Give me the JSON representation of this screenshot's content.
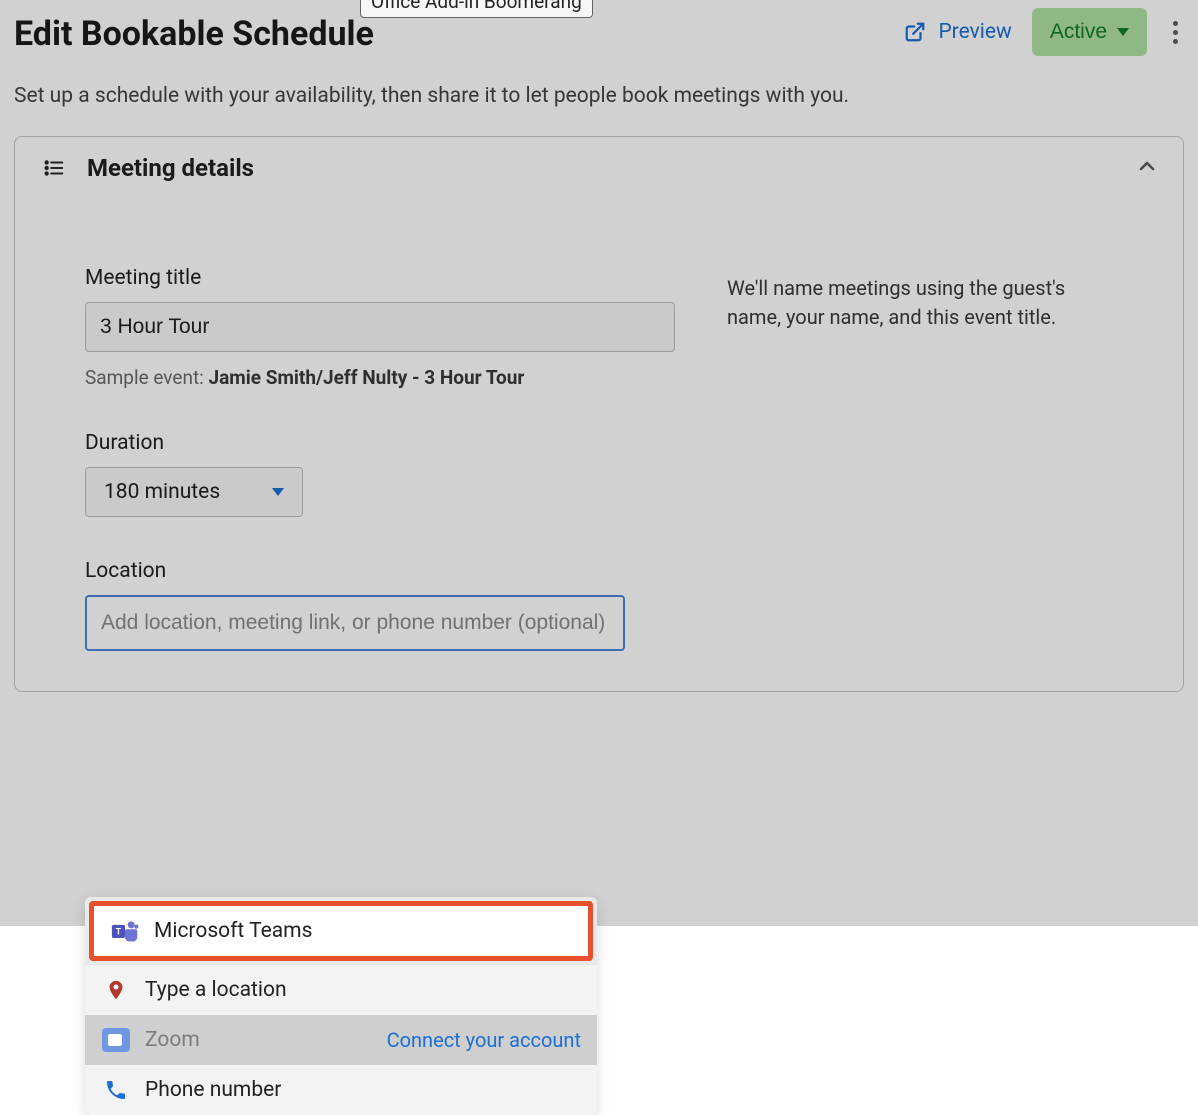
{
  "header": {
    "title": "Edit Bookable Schedule",
    "preview_label": "Preview",
    "active_label": "Active",
    "subtitle": "Set up a schedule with your availability, then share it to let people book meetings with you."
  },
  "section": {
    "title": "Meeting details",
    "hover_badge": "Office Add-in Boomerang"
  },
  "form": {
    "meeting_title_label": "Meeting title",
    "meeting_title_value": "3 Hour Tour",
    "sample_prefix": "Sample event: ",
    "sample_value": "Jamie Smith/Jeff Nulty - 3 Hour Tour",
    "info_text": "We'll name meetings using the guest's name, your name, and this event title.",
    "duration_label": "Duration",
    "duration_value": "180 minutes",
    "location_label": "Location",
    "location_placeholder": "Add location, meeting link, or phone number (optional)"
  },
  "location_options": [
    {
      "label": "Microsoft Teams"
    },
    {
      "label": "Type a location"
    },
    {
      "label": "Zoom",
      "right_link": "Connect your account"
    },
    {
      "label": "Phone number"
    }
  ]
}
